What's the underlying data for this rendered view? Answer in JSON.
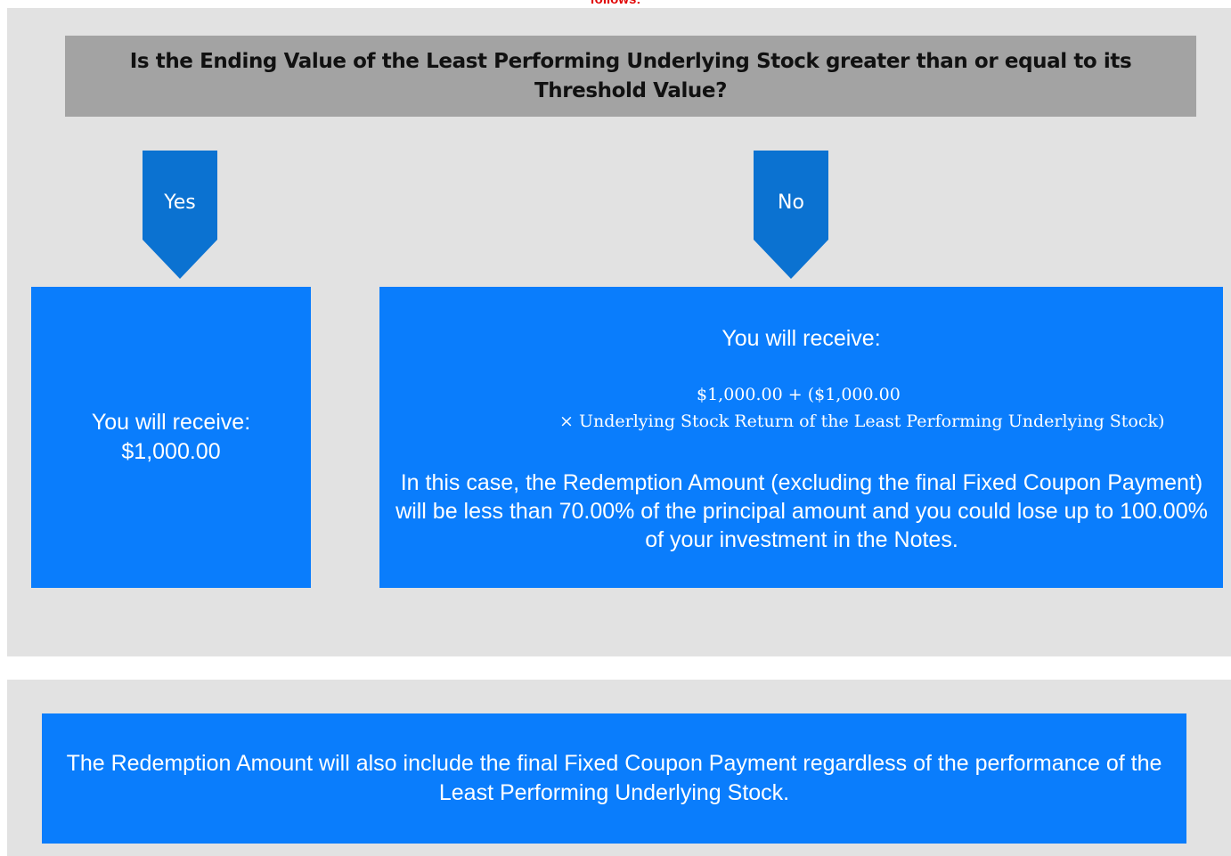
{
  "caption": "follows:",
  "question": "Is the Ending Value of the Least Performing Underlying Stock greater than or equal to its Threshold Value?",
  "branches": {
    "yes": {
      "label": "Yes",
      "heading": "You will receive:",
      "amount": "$1,000.00"
    },
    "no": {
      "label": "No",
      "heading": "You will receive:",
      "formula_line_1": "$1,000.00 + ($1,000.00",
      "formula_line_2": "× Underlying Stock Return of the Least Performing Underlying Stock)",
      "explanation": "In this case, the Redemption Amount (excluding the final Fixed Coupon Payment) will be less than 70.00% of the principal amount and you could lose up to 100.00% of your investment in the Notes."
    }
  },
  "footer_note": "The Redemption Amount will also include the final Fixed Coupon Payment regardless of the performance of the Least Performing Underlying Stock.",
  "colors": {
    "panel_background": "#e2e2e2",
    "question_background": "#a3a3a3",
    "box_blue": "#0a7dfc",
    "arrow_blue": "#0b72d1",
    "caption_red": "#e00000"
  }
}
